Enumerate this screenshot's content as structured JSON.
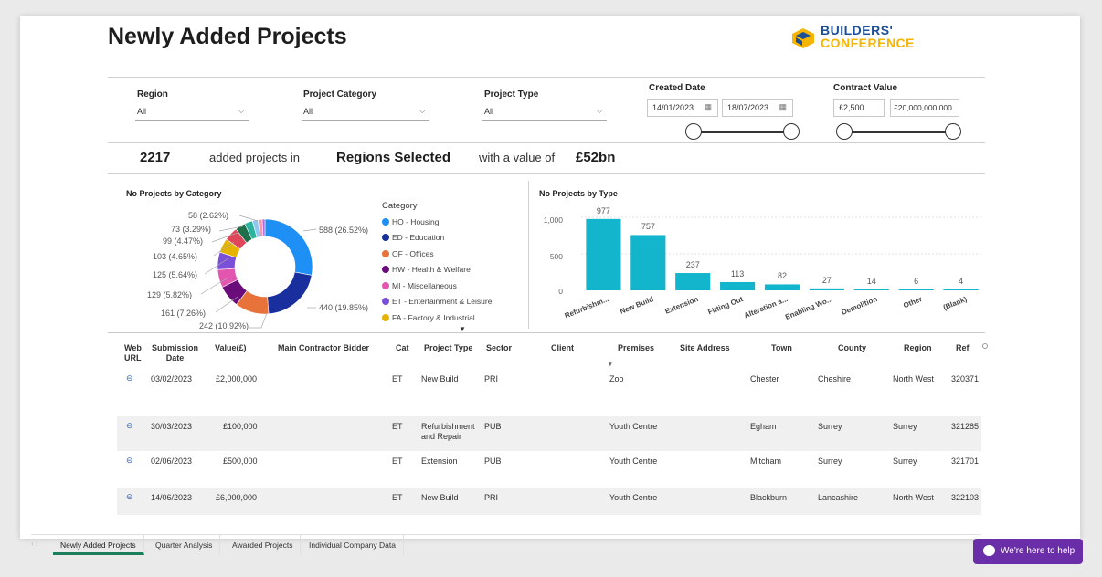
{
  "page": {
    "title": "Newly Added Projects"
  },
  "brand": {
    "line1": "BUILDERS'",
    "line2": "CONFERENCE",
    "blue": "#1b4f99",
    "yellow": "#f4b400"
  },
  "filters": {
    "region": {
      "label": "Region",
      "value": "All"
    },
    "category": {
      "label": "Project Category",
      "value": "All"
    },
    "type": {
      "label": "Project Type",
      "value": "All"
    },
    "created": {
      "label": "Created Date",
      "from": "14/01/2023",
      "to": "18/07/2023"
    },
    "contract": {
      "label": "Contract Value",
      "min": "£2,500",
      "max": "£20,000,000,000"
    }
  },
  "summary": {
    "count": "2217",
    "text1": "added projects in",
    "regions": "Regions Selected",
    "text2": "with a value of",
    "value": "£52bn"
  },
  "donut_chart": {
    "title": "No Projects by Category",
    "legend_title": "Category",
    "legend": [
      {
        "label": "HO - Housing",
        "color": "#1e90f5"
      },
      {
        "label": "ED - Education",
        "color": "#1a2f9e"
      },
      {
        "label": "OF - Offices",
        "color": "#e8733a"
      },
      {
        "label": "HW - Health & Welfare",
        "color": "#6a0c7a"
      },
      {
        "label": "MI - Miscellaneous",
        "color": "#e356b0"
      },
      {
        "label": "ET - Entertainment & Leisure",
        "color": "#7b50d9"
      },
      {
        "label": "FA - Factory & Industrial",
        "color": "#e6b400"
      }
    ],
    "labels": [
      "588 (26.52%)",
      "440 (19.85%)",
      "242 (10.92%)",
      "161 (7.26%)",
      "129 (5.82%)",
      "125 (5.64%)",
      "103 (4.65%)",
      "99 (4.47%)",
      "73 (3.29%)",
      "58 (2.62%)"
    ]
  },
  "bar_chart": {
    "title": "No Projects by Type",
    "ticks": [
      "1,000",
      "500",
      "0"
    ]
  },
  "chart_data": [
    {
      "type": "pie",
      "title": "No Projects by Category",
      "categories": [
        "HO - Housing",
        "ED - Education",
        "OF - Offices",
        "HW - Health & Welfare",
        "MI - Miscellaneous",
        "ET - Entertainment & Leisure",
        "FA - Factory & Industrial",
        "",
        "",
        "",
        "",
        "",
        ""
      ],
      "values": [
        588,
        440,
        242,
        161,
        129,
        125,
        103,
        99,
        73,
        58,
        40,
        30,
        20
      ],
      "colors": [
        "#1e90f5",
        "#1a2f9e",
        "#e8733a",
        "#6a0c7a",
        "#e356b0",
        "#7b50d9",
        "#e6b400",
        "#e0465a",
        "#1f6f4a",
        "#2bb3a0",
        "#8fc7f0",
        "#f29ab0",
        "#b36cd9"
      ]
    },
    {
      "type": "bar",
      "title": "No Projects by Type",
      "categories": [
        "Refurbishm...",
        "New Build",
        "Extension",
        "Fitting Out",
        "Alteration a...",
        "Enabling Wo...",
        "Demolition",
        "Other",
        "(Blank)"
      ],
      "values": [
        977,
        757,
        237,
        113,
        82,
        27,
        14,
        6,
        4
      ],
      "ylim": [
        0,
        1100
      ],
      "color": "#12b5cb"
    }
  ],
  "table": {
    "headers": [
      "Web URL",
      "Submission Date",
      "Value(£)",
      "Main Contractor Bidder",
      "Cat",
      "Project Type",
      "Sector",
      "Client",
      "Premises",
      "Site Address",
      "Town",
      "County",
      "Region",
      "Ref"
    ],
    "rows": [
      {
        "date": "03/02/2023",
        "value": "£2,000,000",
        "cat": "ET",
        "type": "New Build",
        "sector": "PRI",
        "premises": "Zoo",
        "town": "Chester",
        "county": "Cheshire",
        "region": "North West",
        "ref": "320371"
      },
      {
        "date": "30/03/2023",
        "value": "£100,000",
        "cat": "ET",
        "type": "Refurbishment and Repair",
        "sector": "PUB",
        "premises": "Youth Centre",
        "town": "Egham",
        "county": "Surrey",
        "region": "Surrey",
        "ref": "321285"
      },
      {
        "date": "02/06/2023",
        "value": "£500,000",
        "cat": "ET",
        "type": "Extension",
        "sector": "PUB",
        "premises": "Youth Centre",
        "town": "Mitcham",
        "county": "Surrey",
        "region": "Surrey",
        "ref": "321701"
      },
      {
        "date": "14/06/2023",
        "value": "£6,000,000",
        "cat": "ET",
        "type": "New Build",
        "sector": "PRI",
        "premises": "Youth Centre",
        "town": "Blackburn",
        "county": "Lancashire",
        "region": "North West",
        "ref": "322103"
      }
    ]
  },
  "tabs": [
    "Newly Added Projects",
    "Quarter Analysis",
    "Awarded Projects",
    "Individual Company Data"
  ],
  "help": {
    "label": "We're here to help"
  }
}
